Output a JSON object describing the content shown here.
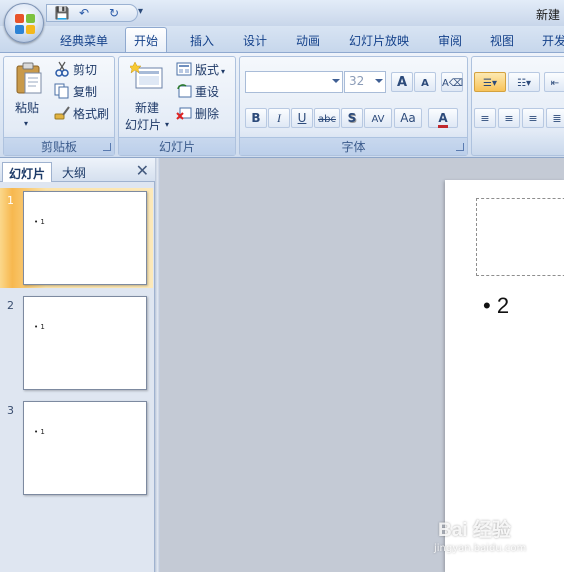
{
  "window": {
    "title": "新建"
  },
  "quick_access": {
    "buttons": [
      {
        "name": "save-icon",
        "glyph": "💾"
      },
      {
        "name": "undo-icon",
        "glyph": "↶"
      },
      {
        "name": "redo-icon",
        "glyph": "↻"
      }
    ],
    "more": "▾"
  },
  "tabs": [
    {
      "label": "经典菜单"
    },
    {
      "label": "开始",
      "active": true
    },
    {
      "label": "插入"
    },
    {
      "label": "设计"
    },
    {
      "label": "动画"
    },
    {
      "label": "幻灯片放映"
    },
    {
      "label": "审阅"
    },
    {
      "label": "视图"
    },
    {
      "label": "开发"
    }
  ],
  "clipboard": {
    "label": "剪贴板",
    "paste": "粘贴",
    "cut": "剪切",
    "copy": "复制",
    "format_painter": "格式刷"
  },
  "slides_group": {
    "label": "幻灯片",
    "new_slide_line1": "新建",
    "new_slide_line2": "幻灯片",
    "layout": "版式",
    "reset": "重设",
    "delete": "删除"
  },
  "font": {
    "label": "字体",
    "font_name": "",
    "font_size": "32",
    "bold": "B",
    "italic": "I",
    "underline": "U",
    "strike": "abc",
    "shadow": "S",
    "spacing": "AV",
    "case": "Aa",
    "color": "A",
    "grow": "A",
    "shrink": "A"
  },
  "panel": {
    "tab_slides": "幻灯片",
    "tab_outline": "大纲",
    "close": "✕"
  },
  "thumbnails": [
    {
      "number": "1",
      "text": "• 1",
      "selected": true
    },
    {
      "number": "2",
      "text": "• 1"
    },
    {
      "number": "3",
      "text": "• 1"
    }
  ],
  "slide": {
    "bullet_text": "2"
  },
  "watermark": {
    "main": "Bai 经验",
    "sub": "jingyan.baidu.com"
  }
}
